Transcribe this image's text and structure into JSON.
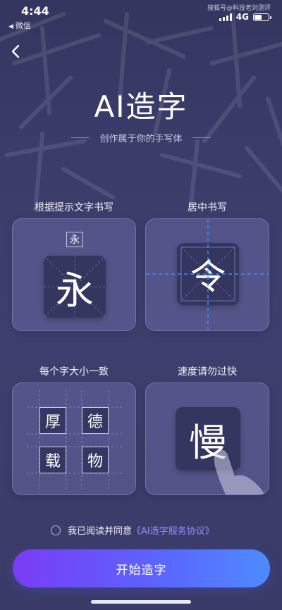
{
  "status_bar": {
    "time": "4:44",
    "back_app": "微信",
    "network": "4G",
    "battery_level": 0.55,
    "watermark": "搜狐号@科技老刘测评"
  },
  "hero": {
    "title": "AI造字",
    "subtitle": "创作属于你的手写体"
  },
  "tips": [
    {
      "title": "根据提示文字书写",
      "hint_char": "永",
      "char": "永"
    },
    {
      "title": "居中书写",
      "char": "令"
    },
    {
      "title": "每个字大小一致",
      "chars": [
        "厚",
        "德",
        "载",
        "物"
      ]
    },
    {
      "title": "速度请勿过快",
      "char": "慢"
    }
  ],
  "agreement": {
    "prefix": "我已阅读并同意",
    "link": "《AI造字服务协议》"
  },
  "start_button": {
    "label": "开始造字"
  },
  "colors": {
    "accent_link": "#8b90ff",
    "button_start": "#7a3cf5",
    "button_end": "#4d8bff",
    "guide_line": "#3f8dff"
  }
}
